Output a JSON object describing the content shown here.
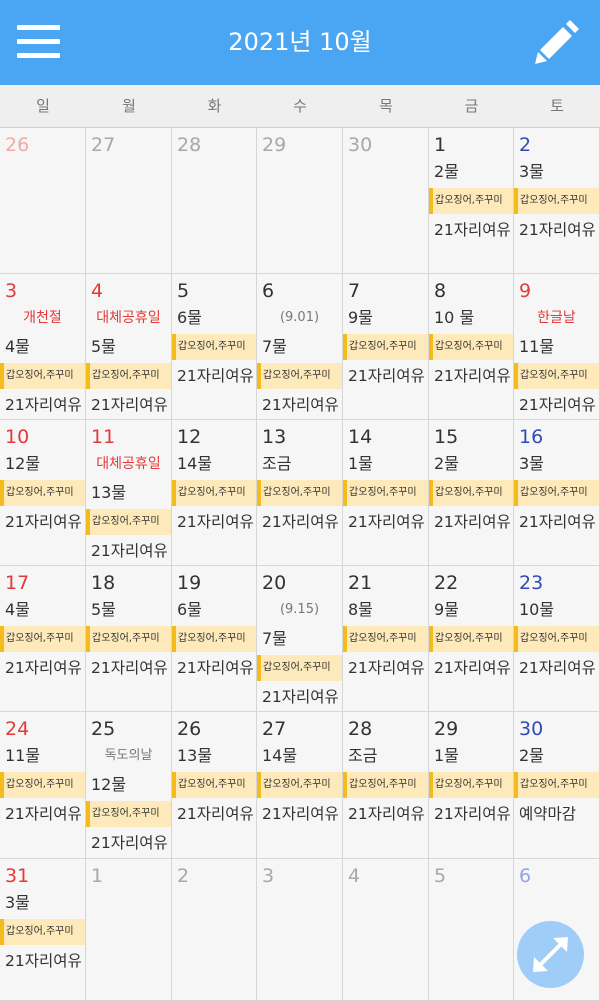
{
  "header": {
    "title": "2021년 10월"
  },
  "weekdays": [
    "일",
    "월",
    "화",
    "수",
    "목",
    "금",
    "토"
  ],
  "colors": {
    "header_bg": "#4aa6f3",
    "sunday": "#e23a3a",
    "saturday": "#2f4bb8",
    "muted": "#a8a8a8",
    "muted_sunday": "#f2a9a9",
    "muted_saturday": "#8fa3e8",
    "badge_bg": "#fde9b9",
    "badge_edge": "#f3bc1c"
  },
  "weeks": [
    [
      {
        "day": "26",
        "muted": true
      },
      {
        "day": "27",
        "muted": true
      },
      {
        "day": "28",
        "muted": true
      },
      {
        "day": "29",
        "muted": true
      },
      {
        "day": "30",
        "muted": true
      },
      {
        "day": "1",
        "tide": "2물",
        "badge": "갑오징어,주꾸미",
        "status": "21자리여유"
      },
      {
        "day": "2",
        "tide": "3물",
        "badge": "갑오징어,주꾸미",
        "status": "21자리여유"
      }
    ],
    [
      {
        "day": "3",
        "holiday": "개천절",
        "tide": "4물",
        "badge": "갑오징어,주꾸미",
        "status": "21자리여유"
      },
      {
        "day": "4",
        "holiday": "대체공휴일",
        "tide": "5물",
        "badge": "갑오징어,주꾸미",
        "status": "21자리여유"
      },
      {
        "day": "5",
        "tide": "6물",
        "badge": "갑오징어,주꾸미",
        "status": "21자리여유"
      },
      {
        "day": "6",
        "lunar": "(9.01)",
        "tide": "7물",
        "badge": "갑오징어,주꾸미",
        "status": "21자리여유"
      },
      {
        "day": "7",
        "tide": "9물",
        "badge": "갑오징어,주꾸미",
        "status": "21자리여유"
      },
      {
        "day": "8",
        "tide": "10 물",
        "badge": "갑오징어,주꾸미",
        "status": "21자리여유"
      },
      {
        "day": "9",
        "holiday": "한글날",
        "tide": "11물",
        "badge": "갑오징어,주꾸미",
        "status": "21자리여유"
      }
    ],
    [
      {
        "day": "10",
        "tide": "12물",
        "badge": "갑오징어,주꾸미",
        "status": "21자리여유"
      },
      {
        "day": "11",
        "holiday": "대체공휴일",
        "tide": "13물",
        "badge": "갑오징어,주꾸미",
        "status": "21자리여유"
      },
      {
        "day": "12",
        "tide": "14물",
        "badge": "갑오징어,주꾸미",
        "status": "21자리여유"
      },
      {
        "day": "13",
        "tide": "조금",
        "badge": "갑오징어,주꾸미",
        "status": "21자리여유"
      },
      {
        "day": "14",
        "tide": "1물",
        "badge": "갑오징어,주꾸미",
        "status": "21자리여유"
      },
      {
        "day": "15",
        "tide": "2물",
        "badge": "갑오징어,주꾸미",
        "status": "21자리여유"
      },
      {
        "day": "16",
        "tide": "3물",
        "badge": "갑오징어,주꾸미",
        "status": "21자리여유"
      }
    ],
    [
      {
        "day": "17",
        "tide": "4물",
        "badge": "갑오징어,주꾸미",
        "status": "21자리여유"
      },
      {
        "day": "18",
        "tide": "5물",
        "badge": "갑오징어,주꾸미",
        "status": "21자리여유"
      },
      {
        "day": "19",
        "tide": "6물",
        "badge": "갑오징어,주꾸미",
        "status": "21자리여유"
      },
      {
        "day": "20",
        "lunar": "(9.15)",
        "tide": "7물",
        "badge": "갑오징어,주꾸미",
        "status": "21자리여유"
      },
      {
        "day": "21",
        "tide": "8물",
        "badge": "갑오징어,주꾸미",
        "status": "21자리여유"
      },
      {
        "day": "22",
        "tide": "9물",
        "badge": "갑오징어,주꾸미",
        "status": "21자리여유"
      },
      {
        "day": "23",
        "tide": "10물",
        "badge": "갑오징어,주꾸미",
        "status": "21자리여유"
      }
    ],
    [
      {
        "day": "24",
        "tide": "11물",
        "badge": "갑오징어,주꾸미",
        "status": "21자리여유"
      },
      {
        "day": "25",
        "lunar": "독도의날",
        "tide": "12물",
        "badge": "갑오징어,주꾸미",
        "status": "21자리여유"
      },
      {
        "day": "26",
        "tide": "13물",
        "badge": "갑오징어,주꾸미",
        "status": "21자리여유"
      },
      {
        "day": "27",
        "tide": "14물",
        "badge": "갑오징어,주꾸미",
        "status": "21자리여유"
      },
      {
        "day": "28",
        "tide": "조금",
        "badge": "갑오징어,주꾸미",
        "status": "21자리여유"
      },
      {
        "day": "29",
        "tide": "1물",
        "badge": "갑오징어,주꾸미",
        "status": "21자리여유"
      },
      {
        "day": "30",
        "tide": "2물",
        "badge": "갑오징어,주꾸미",
        "status": "예약마감"
      }
    ],
    [
      {
        "day": "31",
        "tide": "3물",
        "badge": "갑오징어,주꾸미",
        "status": "21자리여유"
      },
      {
        "day": "1",
        "muted": true
      },
      {
        "day": "2",
        "muted": true
      },
      {
        "day": "3",
        "muted": true
      },
      {
        "day": "4",
        "muted": true
      },
      {
        "day": "5",
        "muted": true
      },
      {
        "day": "6",
        "muted": true
      }
    ]
  ]
}
